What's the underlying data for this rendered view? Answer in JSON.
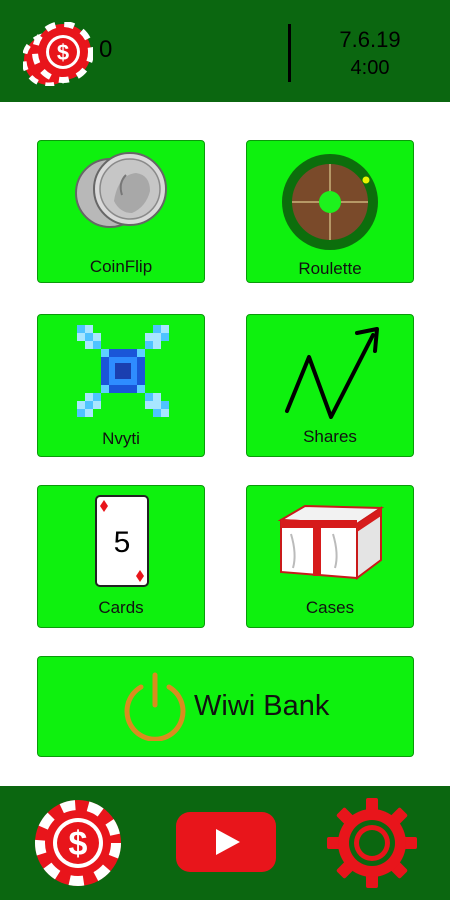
{
  "header": {
    "balance": "0",
    "date": "7.6.19",
    "time": "4:00"
  },
  "games": [
    {
      "label": "CoinFlip",
      "icon": "coins-icon"
    },
    {
      "label": "Roulette",
      "icon": "roulette-wheel-icon"
    },
    {
      "label": "Nvyti",
      "icon": "pixel-cross-icon"
    },
    {
      "label": "Shares",
      "icon": "zigzag-arrow-icon"
    },
    {
      "label": "Cards",
      "icon": "playing-card-icon",
      "card_value": "5"
    },
    {
      "label": "Cases",
      "icon": "crate-icon"
    }
  ],
  "bank": {
    "label": "Wiwi Bank",
    "icon": "power-icon"
  },
  "footer": {
    "chip": "casino-chip-icon",
    "video": "youtube-play-icon",
    "settings": "gear-icon"
  },
  "colors": {
    "bar": "#0b6710",
    "tile": "#0ef10e",
    "chip_red": "#e8151b",
    "power_orange": "#d98c1f"
  }
}
